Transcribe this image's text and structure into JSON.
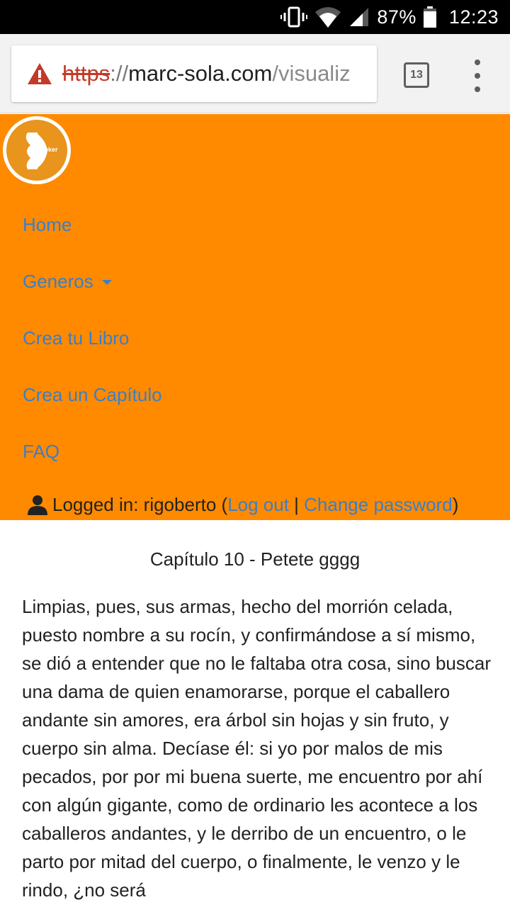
{
  "status_bar": {
    "battery_percent": "87%",
    "time": "12:23",
    "icons": [
      "vibrate-icon",
      "wifi-icon",
      "cell-signal-icon",
      "battery-icon"
    ]
  },
  "browser": {
    "url_scheme": "https",
    "url_separator": "://",
    "url_host": "marc-sola.com",
    "url_path": "/visualiz",
    "tab_count": "13",
    "security": "not-secure-warning",
    "warning_color": "#c53929"
  },
  "site": {
    "brand_color": "#ff8a00",
    "link_color": "#3a7fc8",
    "logo_text": "ooker",
    "nav": [
      {
        "label": "Home"
      },
      {
        "label": "Generos",
        "has_dropdown": true
      },
      {
        "label": "Crea tu Libro"
      },
      {
        "label": "Crea un Capítulo"
      },
      {
        "label": "FAQ"
      }
    ],
    "user": {
      "logged_in_label": "Logged in: rigoberto",
      "open_paren": " (",
      "logout_label": "Log out",
      "divider": " | ",
      "change_password_label": "Change password",
      "close_paren": ")"
    }
  },
  "chapter": {
    "title": "Capítulo 10 - Petete gggg",
    "body": "Limpias, pues, sus armas, hecho del morrión celada, puesto nombre a su rocín, y confirmándose a sí mismo, se dió a entender que no le faltaba otra cosa, sino buscar una dama de quien enamorarse, porque el caballero andante sin amores, era árbol sin hojas y sin fruto, y cuerpo sin alma. Decíase él: si yo por malos de mis pecados, por por mi buena suerte, me encuentro por ahí con algún gigante, como de ordinario les acontece a los caballeros andantes, y le derribo de un encuentro, o le parto por mitad del cuerpo, o finalmente, le venzo y le rindo, ¿no será"
  }
}
